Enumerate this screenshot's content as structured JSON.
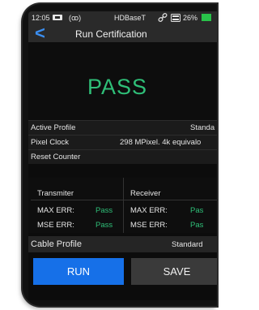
{
  "status": {
    "time": "12:05",
    "signal": "(ꝏ)",
    "source": "HDBaseT",
    "battery": "26%"
  },
  "header": {
    "title": "Run Certification",
    "back_label": "<"
  },
  "result": "PASS",
  "info_rows": [
    {
      "label": "Active Profile",
      "value": "Standa"
    },
    {
      "label": "Pixel Clock",
      "value": "298 MPixel. 4k equivalo"
    },
    {
      "label": "Reset Counter",
      "value": ""
    }
  ],
  "matrix": {
    "transmitter": {
      "title": "Transmiter",
      "rows": [
        {
          "label": "MAX ERR:",
          "value": "Pass"
        },
        {
          "label": "MSE ERR:",
          "value": "Pass"
        }
      ]
    },
    "receiver": {
      "title": "Receiver",
      "rows": [
        {
          "label": "MAX ERR:",
          "value": "Pas"
        },
        {
          "label": "MSE ERR:",
          "value": "Pas"
        }
      ]
    }
  },
  "cable": {
    "label": "Cable Profile",
    "value": "Standard"
  },
  "buttons": {
    "run": "RUN",
    "save": "SAVE"
  },
  "colors": {
    "accent": "#1670e8",
    "pass": "#2fbf78",
    "back": "#3b8ef0"
  },
  "icons": [
    "back-icon",
    "hdmi-icon",
    "wifi-icon",
    "link-icon",
    "card-icon",
    "battery-icon"
  ]
}
